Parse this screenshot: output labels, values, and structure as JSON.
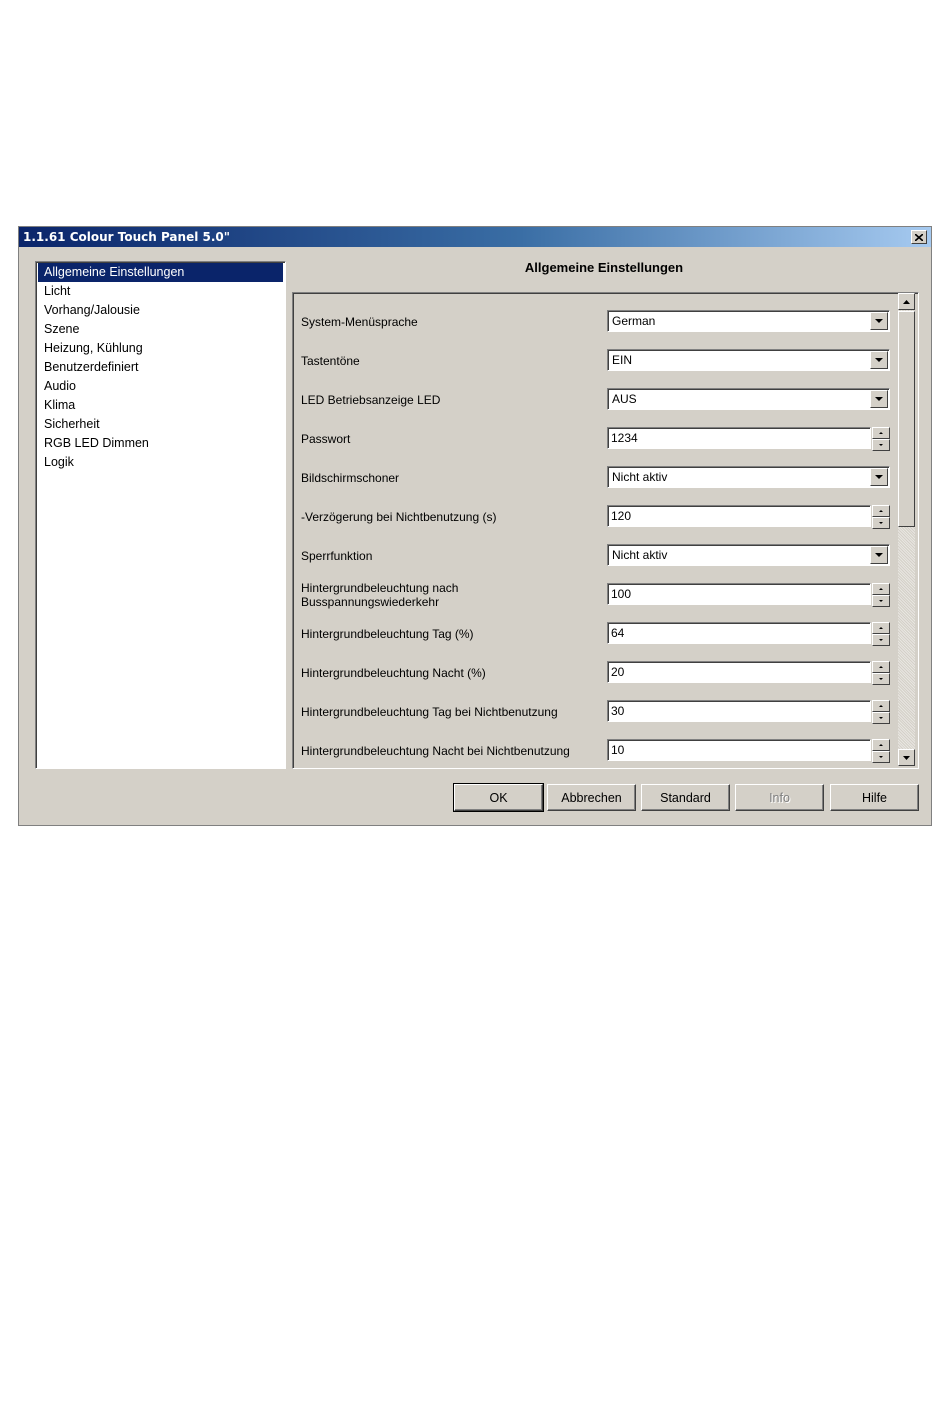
{
  "window": {
    "title": "1.1.61 Colour Touch Panel 5.0\""
  },
  "sidebar": {
    "items": [
      {
        "label": "Allgemeine Einstellungen",
        "selected": true
      },
      {
        "label": "Licht"
      },
      {
        "label": "Vorhang/Jalousie"
      },
      {
        "label": "Szene"
      },
      {
        "label": "Heizung, Kühlung"
      },
      {
        "label": "Benutzerdefiniert"
      },
      {
        "label": "Audio"
      },
      {
        "label": "Klima"
      },
      {
        "label": "Sicherheit"
      },
      {
        "label": "RGB LED Dimmen"
      },
      {
        "label": "Logik"
      }
    ]
  },
  "main": {
    "heading": "Allgemeine Einstellungen",
    "params": [
      {
        "label": "System-Menüsprache",
        "type": "select",
        "value": "German"
      },
      {
        "label": "Tastentöne",
        "type": "select",
        "value": "EIN"
      },
      {
        "label": "LED Betriebsanzeige LED",
        "type": "select",
        "value": "AUS"
      },
      {
        "label": "Passwort",
        "type": "number",
        "value": "1234"
      },
      {
        "label": "Bildschirmschoner",
        "type": "select",
        "value": "Nicht aktiv"
      },
      {
        "label": "-Verzögerung bei Nichtbenutzung (s)",
        "type": "number",
        "value": "120"
      },
      {
        "label": "Sperrfunktion",
        "type": "select",
        "value": "Nicht aktiv"
      },
      {
        "label": "Hintergrundbeleuchtung nach\nBusspannungswiederkehr",
        "type": "number",
        "value": "100"
      },
      {
        "label": "Hintergrundbeleuchtung Tag (%)",
        "type": "number",
        "value": "64"
      },
      {
        "label": "Hintergrundbeleuchtung Nacht (%)",
        "type": "number",
        "value": "20"
      },
      {
        "label": "Hintergrundbeleuchtung Tag bei Nichtbenutzung",
        "type": "number",
        "value": "30"
      },
      {
        "label": "Hintergrundbeleuchtung Nacht bei Nichtbenutzung",
        "type": "number",
        "value": "10"
      }
    ]
  },
  "buttons": {
    "ok": "OK",
    "cancel": "Abbrechen",
    "standard": "Standard",
    "info": "Info",
    "help": "Hilfe"
  },
  "icons": {
    "close": "close-icon",
    "dropdown": "chevron-down-icon",
    "spin_up": "spin-up-icon",
    "spin_down": "spin-down-icon",
    "scroll_up": "scroll-up-arrow-icon",
    "scroll_down": "scroll-down-arrow-icon"
  }
}
